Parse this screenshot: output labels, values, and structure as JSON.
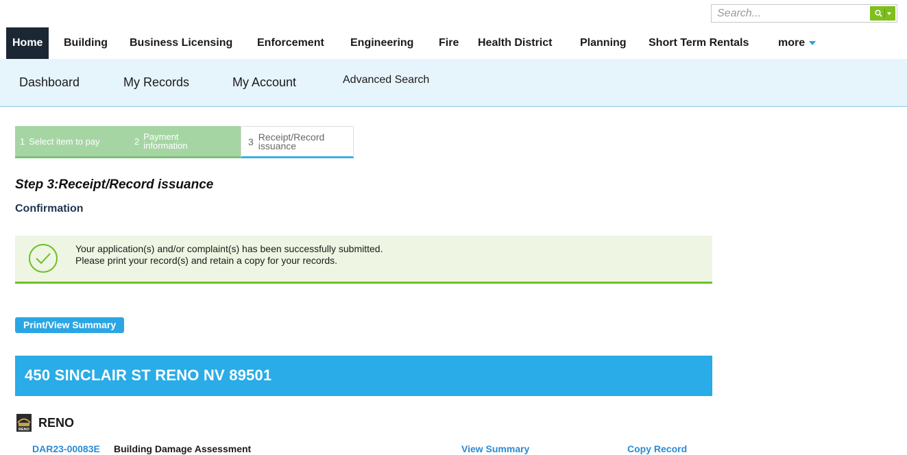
{
  "search": {
    "placeholder": "Search..."
  },
  "colors": {
    "nav_active": "#1c2734",
    "accent_blue": "#29ace8",
    "success_green": "#71bd2b",
    "search_green": "#7fbf1e"
  },
  "topnav": {
    "items": [
      "Home",
      "Building",
      "Business Licensing",
      "Enforcement",
      "Engineering",
      "Fire",
      "Health District",
      "Planning",
      "Short Term Rentals",
      "more"
    ]
  },
  "subnav": {
    "items": [
      "Dashboard",
      "My Records",
      "My Account",
      "Advanced Search"
    ]
  },
  "steps": [
    {
      "num": "1",
      "label": "Select item to pay"
    },
    {
      "num": "2",
      "label_line1": "Payment",
      "label_line2": "information"
    },
    {
      "num": "3",
      "label_line1": "Receipt/Record",
      "label_line2": "issuance"
    }
  ],
  "page": {
    "step_title": "Step 3:Receipt/Record issuance",
    "confirmation_heading": "Confirmation"
  },
  "message": {
    "line1": "Your application(s) and/or complaint(s) has been successfully submitted.",
    "line2": "Please print your record(s) and retain a copy for your records.",
    "icon": "check-circle-icon"
  },
  "actions": {
    "print_summary": "Print/View Summary"
  },
  "address": "450 SINCLAIR ST RENO NV 89501",
  "agency": {
    "name": "RENO",
    "logo_text": "RENO"
  },
  "record": {
    "id": "DAR23-00083E",
    "type": "Building Damage Assessment",
    "view_summary": "View Summary",
    "copy_record": "Copy Record"
  }
}
